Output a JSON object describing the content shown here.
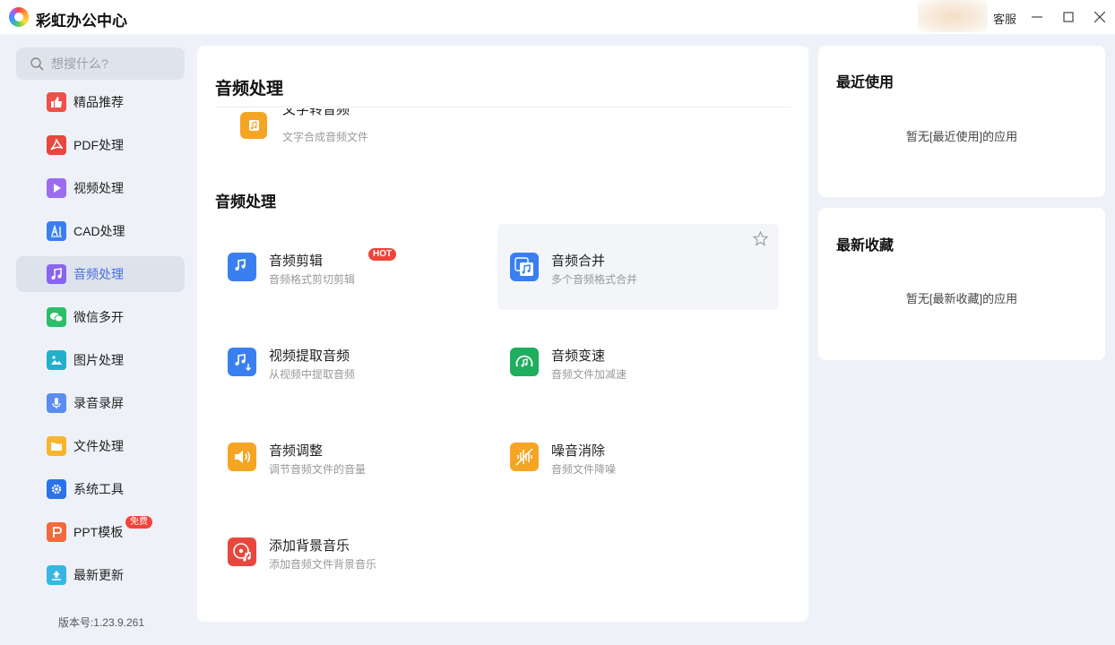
{
  "app": {
    "title": "彩虹办公中心",
    "service_label": "客服"
  },
  "search": {
    "placeholder": "想搜什么?"
  },
  "sidebar": {
    "items": [
      {
        "label": "精品推荐",
        "icon": "thumbs-up-icon",
        "color": "#f0504a"
      },
      {
        "label": "PDF处理",
        "icon": "pdf-icon",
        "color": "#e8473d"
      },
      {
        "label": "视频处理",
        "icon": "video-play-icon",
        "color": "#9b6cf0"
      },
      {
        "label": "CAD处理",
        "icon": "cad-icon",
        "color": "#3a7ff0"
      },
      {
        "label": "音频处理",
        "icon": "music-note-icon",
        "color": "#8a63ef",
        "active": true
      },
      {
        "label": "微信多开",
        "icon": "wechat-icon",
        "color": "#2bbf6a"
      },
      {
        "label": "图片处理",
        "icon": "image-icon",
        "color": "#22b0c9"
      },
      {
        "label": "录音录屏",
        "icon": "microphone-icon",
        "color": "#5a8df0"
      },
      {
        "label": "文件处理",
        "icon": "folder-icon",
        "color": "#f7b52a"
      },
      {
        "label": "系统工具",
        "icon": "gear-icon",
        "color": "#2a73e8"
      },
      {
        "label": "PPT模板",
        "icon": "ppt-icon",
        "color": "#f06a3c",
        "badge": "免费"
      },
      {
        "label": "最新更新",
        "icon": "upload-icon",
        "color": "#36b6e3"
      }
    ],
    "version": "版本号:1.23.9.261"
  },
  "main": {
    "title": "音频处理",
    "partial_item": {
      "name": "文字转音频",
      "desc": "文字合成音频文件"
    },
    "section_title": "音频处理",
    "tools": [
      {
        "name": "音频剪辑",
        "desc": "音频格式剪切剪辑",
        "badge": "HOT",
        "icon": "audio-cut-icon",
        "color": "#3a7ff0"
      },
      {
        "name": "音频合并",
        "desc": "多个音频格式合并",
        "icon": "audio-merge-icon",
        "color": "#3a7ff0"
      },
      {
        "name": "视频提取音频",
        "desc": "从视频中提取音频",
        "icon": "audio-extract-icon",
        "color": "#3a7ff0"
      },
      {
        "name": "音频变速",
        "desc": "音频文件加减速",
        "icon": "audio-speed-icon",
        "color": "#1fae5e"
      },
      {
        "name": "音频调整",
        "desc": "调节音频文件的音量",
        "icon": "volume-icon",
        "color": "#f5a524"
      },
      {
        "name": "噪音消除",
        "desc": "音频文件降噪",
        "icon": "noise-cancel-icon",
        "color": "#f5a524"
      },
      {
        "name": "添加背景音乐",
        "desc": "添加音频文件背景音乐",
        "icon": "music-disc-icon",
        "color": "#e8473d"
      }
    ]
  },
  "recent": {
    "title": "最近使用",
    "empty": "暂无[最近使用]的应用"
  },
  "favorites": {
    "title": "最新收藏",
    "empty": "暂无[最新收藏]的应用"
  }
}
